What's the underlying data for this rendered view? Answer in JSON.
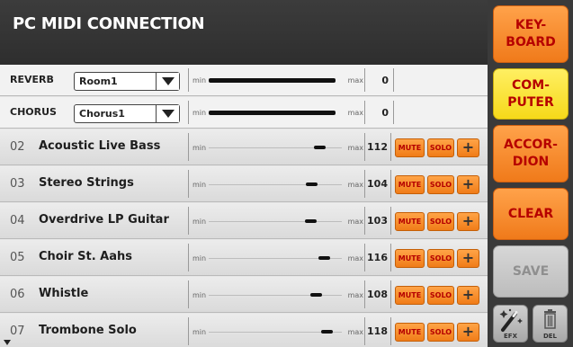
{
  "header": {
    "title": "PC MIDI CONNECTION"
  },
  "effects": [
    {
      "label": "REVERB",
      "selected": "Room1",
      "min": "min",
      "max": "max",
      "value": "0",
      "level": 0.95
    },
    {
      "label": "CHORUS",
      "selected": "Chorus1",
      "min": "min",
      "max": "max",
      "value": "0",
      "level": 0.95
    }
  ],
  "tracks": [
    {
      "num": "02",
      "name": "Acoustic Live Bass",
      "min": "min",
      "max": "max",
      "value": "112",
      "level": 0.88,
      "mute": "MUTE",
      "solo": "SOLO",
      "plus": "+"
    },
    {
      "num": "03",
      "name": "Stereo Strings",
      "min": "min",
      "max": "max",
      "value": "104",
      "level": 0.82,
      "mute": "MUTE",
      "solo": "SOLO",
      "plus": "+"
    },
    {
      "num": "04",
      "name": "Overdrive LP Guitar",
      "min": "min",
      "max": "max",
      "value": "103",
      "level": 0.81,
      "mute": "MUTE",
      "solo": "SOLO",
      "plus": "+"
    },
    {
      "num": "05",
      "name": "Choir St. Aahs",
      "min": "min",
      "max": "max",
      "value": "116",
      "level": 0.91,
      "mute": "MUTE",
      "solo": "SOLO",
      "plus": "+"
    },
    {
      "num": "06",
      "name": "Whistle",
      "min": "min",
      "max": "max",
      "value": "108",
      "level": 0.85,
      "mute": "MUTE",
      "solo": "SOLO",
      "plus": "+"
    },
    {
      "num": "07",
      "name": "Trombone Solo",
      "min": "min",
      "max": "max",
      "value": "118",
      "level": 0.93,
      "mute": "MUTE",
      "solo": "SOLO",
      "plus": "+"
    }
  ],
  "side": {
    "keyboard": "KEY-\nBOARD",
    "computer": "COM-\nPUTER",
    "accordion": "ACCOR-\nDION",
    "clear": "CLEAR",
    "save": "SAVE",
    "efx": "EFX",
    "del": "DEL"
  },
  "icons": {
    "efx": "magic-wand-icon",
    "del": "trash-icon",
    "dropdown": "chevron-down-icon"
  },
  "colors": {
    "accent_orange": "#f07a1a",
    "accent_yellow": "#f6d91a",
    "text_red": "#b60000"
  }
}
